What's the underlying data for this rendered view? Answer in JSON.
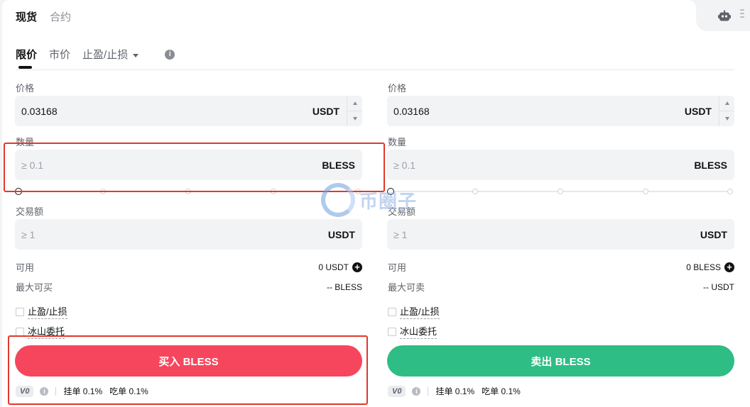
{
  "top_tabs": [
    {
      "label": "现货",
      "active": true
    },
    {
      "label": "合约",
      "active": false
    }
  ],
  "order_tabs": [
    {
      "label": "限价",
      "active": true
    },
    {
      "label": "市价",
      "active": false
    },
    {
      "label": "止盈/止损",
      "active": false,
      "dropdown": true
    }
  ],
  "buy": {
    "price_label": "价格",
    "price_value": "0.03168",
    "price_unit": "USDT",
    "qty_label": "数量",
    "qty_placeholder": "≥ 0.1",
    "qty_unit": "BLESS",
    "amount_label": "交易额",
    "amount_placeholder": "≥ 1",
    "amount_unit": "USDT",
    "available_label": "可用",
    "available_value": "0 USDT",
    "max_label": "最大可买",
    "max_value": "-- BLESS",
    "tpsl_label": "止盈/止损",
    "iceberg_label": "冰山委托",
    "button_label": "买入 BLESS",
    "vip_level": "V0",
    "maker_fee": "挂单 0.1%",
    "taker_fee": "吃单 0.1%",
    "slider_percent": 0
  },
  "sell": {
    "price_label": "价格",
    "price_value": "0.03168",
    "price_unit": "USDT",
    "qty_label": "数量",
    "qty_placeholder": "≥ 0.1",
    "qty_unit": "BLESS",
    "amount_label": "交易额",
    "amount_placeholder": "≥ 1",
    "amount_unit": "USDT",
    "available_label": "可用",
    "available_value": "0 BLESS",
    "max_label": "最大可卖",
    "max_value": "-- USDT",
    "tpsl_label": "止盈/止损",
    "iceberg_label": "冰山委托",
    "button_label": "卖出 BLESS",
    "vip_level": "V0",
    "maker_fee": "挂单 0.1%",
    "taker_fee": "吃单 0.1%",
    "slider_percent": 0
  },
  "watermark": {
    "text": "币圈子"
  },
  "colors": {
    "buy": "#f6465d",
    "sell": "#2ebd85",
    "highlight": "#e0392b"
  },
  "icons": [
    "robot-icon",
    "more-icon",
    "info-icon",
    "plus-icon",
    "chevron-down-icon"
  ]
}
